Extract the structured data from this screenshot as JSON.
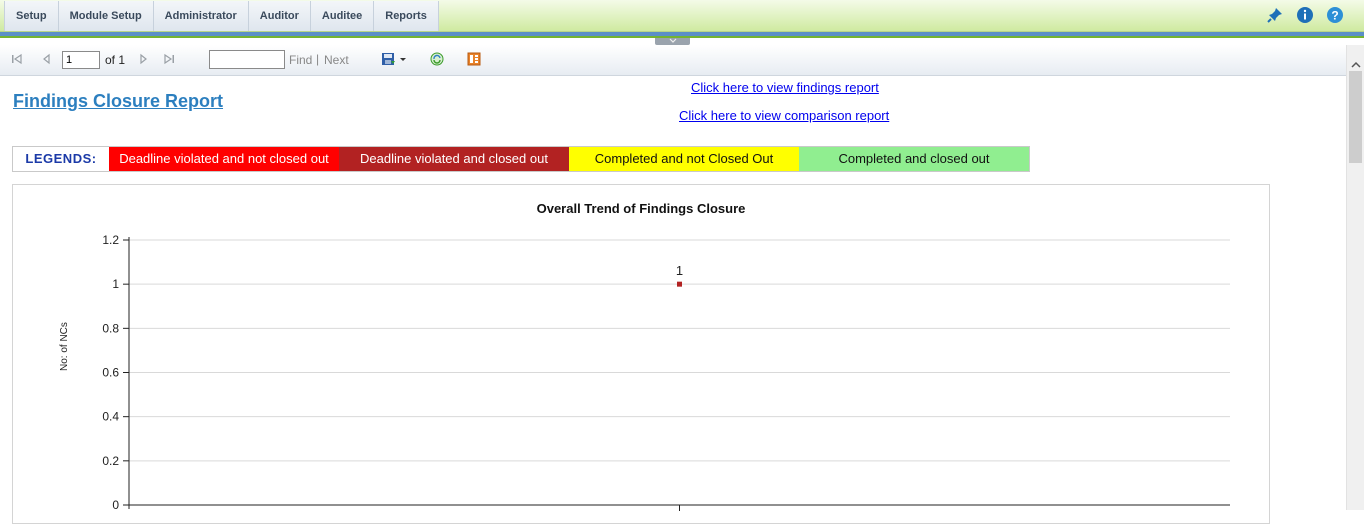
{
  "menu": {
    "items": [
      "Setup",
      "Module Setup",
      "Administrator",
      "Auditor",
      "Auditee",
      "Reports"
    ]
  },
  "top_icons": [
    "pin-icon",
    "info-icon",
    "help-icon"
  ],
  "toolbar": {
    "page_value": "1",
    "of_label": "of 1",
    "find_value": "",
    "find_label": "Find",
    "separator": "|",
    "next_label": "Next"
  },
  "report": {
    "title": "Findings Closure Report",
    "link_findings": "Click here to view findings report",
    "link_comparison": "Click here to view comparison report"
  },
  "legend": {
    "title": "LEGENDS:",
    "items": [
      {
        "label": "Deadline violated and not closed out",
        "color": "#ff0000"
      },
      {
        "label": "Deadline violated and closed out",
        "color": "#b22222"
      },
      {
        "label": "Completed and not Closed Out",
        "color": "#ffff00"
      },
      {
        "label": "Completed and closed out",
        "color": "#90ee90"
      }
    ]
  },
  "chart_data": {
    "type": "scatter",
    "title": "Overall Trend of Findings Closure",
    "ylabel": "No: of NCs",
    "xlabel": "",
    "ylim": [
      0,
      1.2
    ],
    "yticks": [
      "0",
      "0.2",
      "0.4",
      "0.6",
      "0.8",
      "1",
      "1.2"
    ],
    "grid": true,
    "points": [
      {
        "x_index": 0.5,
        "y": 1,
        "label": "1",
        "color": "#b22222"
      }
    ]
  }
}
